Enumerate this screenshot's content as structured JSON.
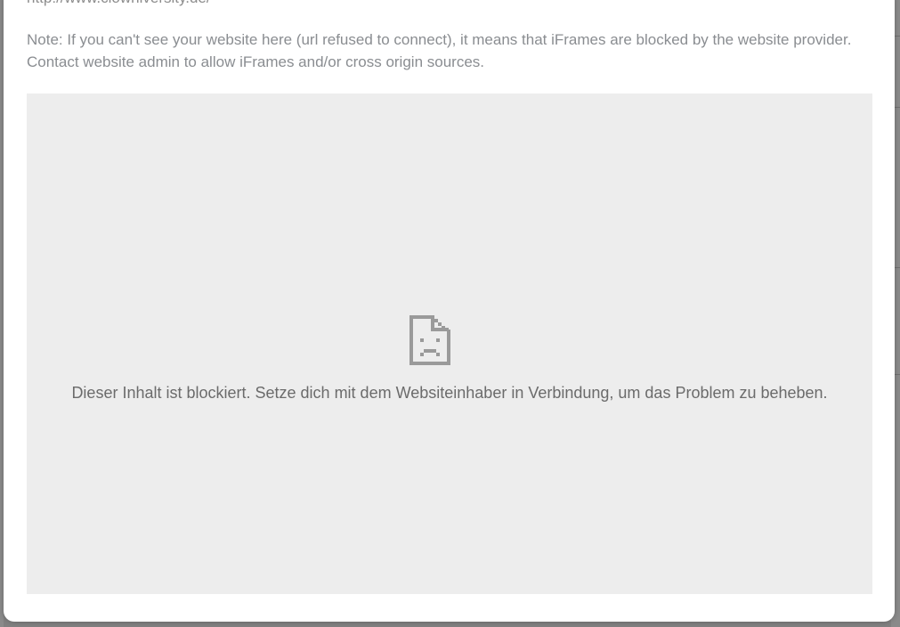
{
  "modal": {
    "url_text": "http://www.clowniversity.de/",
    "note_line1": "Note: If you can't see your website here (url refused to connect), it means that iFrames are blocked by the website provider.",
    "note_line2": "Contact website admin to allow iFrames and/or cross origin sources."
  },
  "iframe": {
    "icon": "sad-document-icon",
    "blocked_message": "Dieser Inhalt ist blockiert. Setze dich mit dem Websiteinhaber in Verbindung, um das Problem zu beheben."
  },
  "colors": {
    "frame_background": "#ededed",
    "note_text": "#8a8d91",
    "icon_gray": "#9a9a9a"
  }
}
